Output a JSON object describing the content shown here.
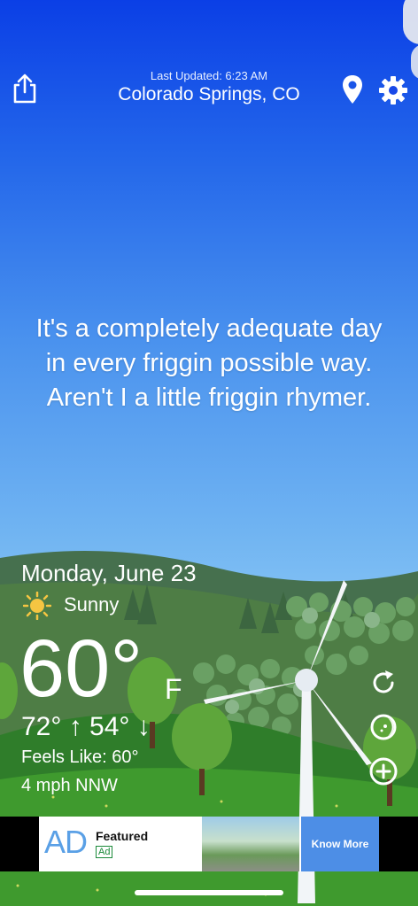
{
  "header": {
    "last_updated": "Last Updated: 6:23 AM",
    "location": "Colorado Springs, CO"
  },
  "icons": {
    "share": "share-icon",
    "location": "location-pin-icon",
    "settings": "gear-icon",
    "refresh": "refresh-icon",
    "radar": "moon-icon",
    "add": "plus-circle-icon",
    "condition": "sun-icon"
  },
  "quote": "It's a completely adequate day in every friggin possible way. Aren't I a little friggin rhymer.",
  "weather": {
    "date": "Monday, June 23",
    "condition": "Sunny",
    "temperature": "60°",
    "unit": "F",
    "high_low": "72° ↑  54° ↓",
    "feels_like": "Feels Like: 60°",
    "wind": "4 mph NNW"
  },
  "ad": {
    "logo": "AD",
    "title": "Featured",
    "badge": "Ad",
    "cta": "Know More"
  },
  "colors": {
    "sky_top": "#0b3fe6",
    "sky_bottom": "#86c4f4",
    "hills": "#3d7a3a",
    "ad_cta": "#4d8ee6"
  }
}
